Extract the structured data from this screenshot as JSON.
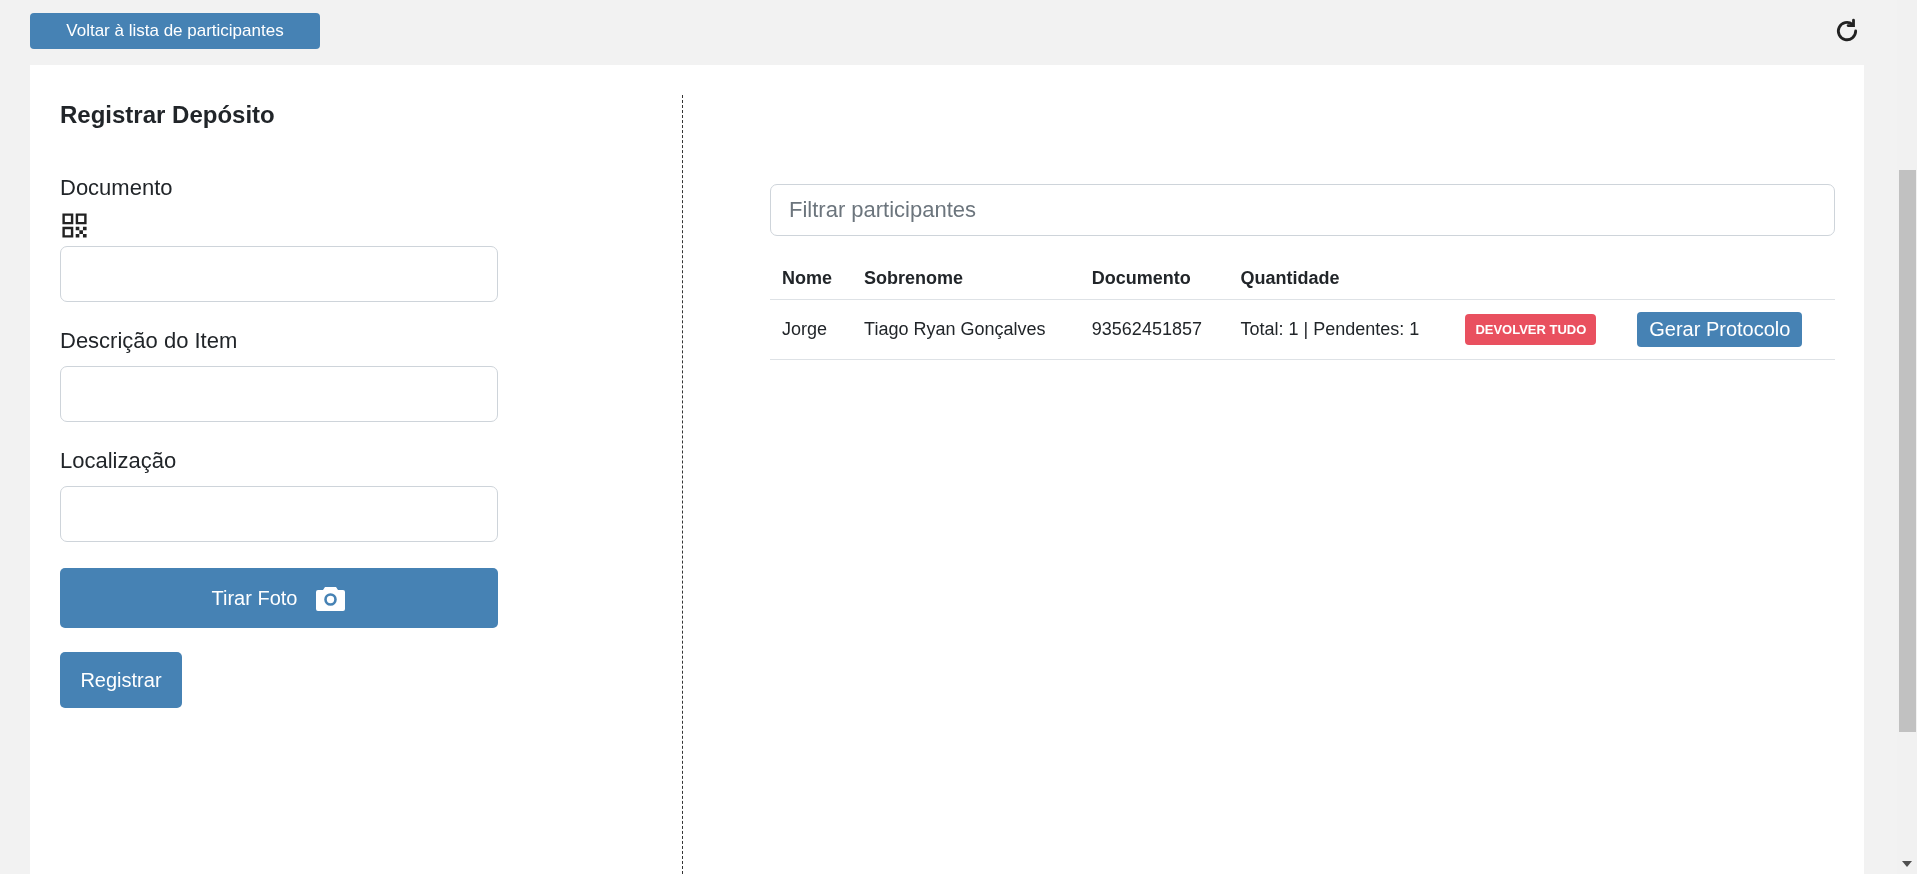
{
  "back_button": "Voltar à lista de participantes",
  "form": {
    "title": "Registrar Depósito",
    "fields": [
      {
        "label": "Documento",
        "kind": "qr"
      },
      {
        "label": "Descrição do Item",
        "kind": "text"
      },
      {
        "label": "Localização",
        "kind": "text"
      }
    ],
    "photo_button": "Tirar Foto",
    "submit_button": "Registrar"
  },
  "filter": {
    "placeholder": "Filtrar participantes"
  },
  "table": {
    "columns": [
      "Nome",
      "Sobrenome",
      "Documento",
      "Quantidade"
    ],
    "rows": [
      {
        "nome": "Jorge",
        "sobrenome": "Tiago Ryan Gonçalves",
        "documento": "93562451857",
        "quantidade": "Total: 1 | Pendentes: 1",
        "return_button": "DEVOLVER TUDO",
        "protocol_button": "Gerar Protocolo"
      }
    ]
  }
}
